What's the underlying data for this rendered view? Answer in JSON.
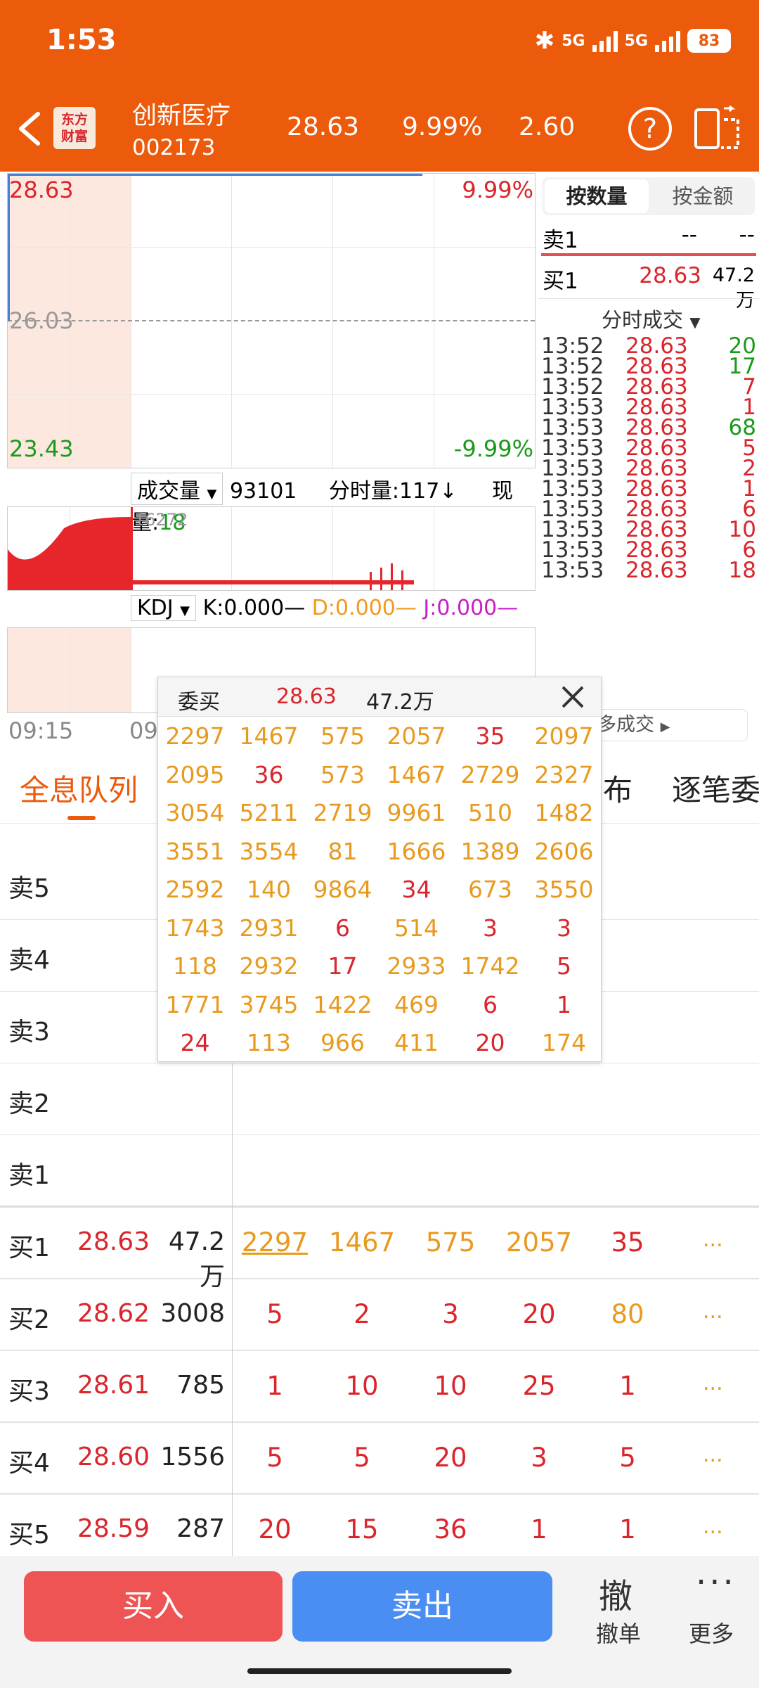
{
  "status": {
    "time": "1:53",
    "battery": "83",
    "network1": "5G",
    "network2": "5G"
  },
  "header": {
    "logo_text": "东方\n财富",
    "stock_name": "创新医疗",
    "stock_code": "002173",
    "price": "28.63",
    "pct": "9.99%",
    "change": "2.60",
    "help": "?"
  },
  "chart": {
    "max_price": "28.63",
    "max_pct": "9.99%",
    "mid_price": "26.03",
    "min_price": "23.43",
    "min_pct": "-9.99%",
    "vol_selector": "成交量",
    "vol_total": "93101",
    "vol_ts_label": "分时量:117↓",
    "vol_now_label": "现量:",
    "vol_now": "18",
    "vol_max": "16272",
    "kdj_selector": "KDJ",
    "k": "K:0.000",
    "d": "D:0.000",
    "j": "J:0.000",
    "time_start": "09:15",
    "time_mid": "09"
  },
  "right_panel": {
    "tabs": [
      "按数量",
      "按金额"
    ],
    "sell1": {
      "label": "卖1",
      "price": "--",
      "vol": "--"
    },
    "buy1": {
      "label": "买1",
      "price": "28.63",
      "vol": "47.2万"
    },
    "ticks_title": "分时成交",
    "ticks": [
      {
        "t": "13:52",
        "p": "28.63",
        "v": "20",
        "c": "green"
      },
      {
        "t": "13:52",
        "p": "28.63",
        "v": "17",
        "c": "green"
      },
      {
        "t": "13:52",
        "p": "28.63",
        "v": "7",
        "c": "red"
      },
      {
        "t": "13:53",
        "p": "28.63",
        "v": "1",
        "c": "red"
      },
      {
        "t": "13:53",
        "p": "28.63",
        "v": "68",
        "c": "green"
      },
      {
        "t": "13:53",
        "p": "28.63",
        "v": "5",
        "c": "red"
      },
      {
        "t": "13:53",
        "p": "28.63",
        "v": "2",
        "c": "red"
      },
      {
        "t": "13:53",
        "p": "28.63",
        "v": "1",
        "c": "red"
      },
      {
        "t": "13:53",
        "p": "28.63",
        "v": "6",
        "c": "red"
      },
      {
        "t": "13:53",
        "p": "28.63",
        "v": "10",
        "c": "red"
      },
      {
        "t": "13:53",
        "p": "28.63",
        "v": "6",
        "c": "red"
      },
      {
        "t": "13:53",
        "p": "28.63",
        "v": "18",
        "c": "red"
      }
    ],
    "more_trades": "更多成交"
  },
  "tabs_row": {
    "queue": "全息队列",
    "dist": "布",
    "each": "逐笔委"
  },
  "order_book": {
    "sells": [
      "卖5",
      "卖4",
      "卖3",
      "卖2",
      "卖1"
    ],
    "buys": [
      {
        "label": "买1",
        "price": "28.63",
        "vol": "47.2万",
        "q": [
          {
            "v": "2297",
            "c": "orange"
          },
          {
            "v": "1467",
            "c": "orange"
          },
          {
            "v": "575",
            "c": "orange"
          },
          {
            "v": "2057",
            "c": "orange"
          },
          {
            "v": "35",
            "c": "red"
          }
        ]
      },
      {
        "label": "买2",
        "price": "28.62",
        "vol": "3008",
        "q": [
          {
            "v": "5",
            "c": "red"
          },
          {
            "v": "2",
            "c": "red"
          },
          {
            "v": "3",
            "c": "red"
          },
          {
            "v": "20",
            "c": "red"
          },
          {
            "v": "80",
            "c": "orange"
          }
        ]
      },
      {
        "label": "买3",
        "price": "28.61",
        "vol": "785",
        "q": [
          {
            "v": "1",
            "c": "red"
          },
          {
            "v": "10",
            "c": "red"
          },
          {
            "v": "10",
            "c": "red"
          },
          {
            "v": "25",
            "c": "red"
          },
          {
            "v": "1",
            "c": "red"
          }
        ]
      },
      {
        "label": "买4",
        "price": "28.60",
        "vol": "1556",
        "q": [
          {
            "v": "5",
            "c": "red"
          },
          {
            "v": "5",
            "c": "red"
          },
          {
            "v": "20",
            "c": "red"
          },
          {
            "v": "3",
            "c": "red"
          },
          {
            "v": "5",
            "c": "red"
          }
        ]
      },
      {
        "label": "买5",
        "price": "28.59",
        "vol": "287",
        "q": [
          {
            "v": "20",
            "c": "red"
          },
          {
            "v": "15",
            "c": "red"
          },
          {
            "v": "36",
            "c": "red"
          },
          {
            "v": "1",
            "c": "red"
          },
          {
            "v": "1",
            "c": "red"
          }
        ]
      }
    ],
    "more": "..."
  },
  "popup": {
    "title": "委买",
    "price": "28.63",
    "vol": "47.2万",
    "grid": [
      [
        {
          "v": "2297",
          "c": "orange"
        },
        {
          "v": "1467",
          "c": "orange"
        },
        {
          "v": "575",
          "c": "orange"
        },
        {
          "v": "2057",
          "c": "orange"
        },
        {
          "v": "35",
          "c": "red"
        },
        {
          "v": "2097",
          "c": "orange"
        }
      ],
      [
        {
          "v": "2095",
          "c": "orange"
        },
        {
          "v": "36",
          "c": "red"
        },
        {
          "v": "573",
          "c": "orange"
        },
        {
          "v": "1467",
          "c": "orange"
        },
        {
          "v": "2729",
          "c": "orange"
        },
        {
          "v": "2327",
          "c": "orange"
        }
      ],
      [
        {
          "v": "3054",
          "c": "orange"
        },
        {
          "v": "5211",
          "c": "orange"
        },
        {
          "v": "2719",
          "c": "orange"
        },
        {
          "v": "9961",
          "c": "orange"
        },
        {
          "v": "510",
          "c": "orange"
        },
        {
          "v": "1482",
          "c": "orange"
        }
      ],
      [
        {
          "v": "3551",
          "c": "orange"
        },
        {
          "v": "3554",
          "c": "orange"
        },
        {
          "v": "81",
          "c": "orange"
        },
        {
          "v": "1666",
          "c": "orange"
        },
        {
          "v": "1389",
          "c": "orange"
        },
        {
          "v": "2606",
          "c": "orange"
        }
      ],
      [
        {
          "v": "2592",
          "c": "orange"
        },
        {
          "v": "140",
          "c": "orange"
        },
        {
          "v": "9864",
          "c": "orange"
        },
        {
          "v": "34",
          "c": "red"
        },
        {
          "v": "673",
          "c": "orange"
        },
        {
          "v": "3550",
          "c": "orange"
        }
      ],
      [
        {
          "v": "1743",
          "c": "orange"
        },
        {
          "v": "2931",
          "c": "orange"
        },
        {
          "v": "6",
          "c": "red"
        },
        {
          "v": "514",
          "c": "orange"
        },
        {
          "v": "3",
          "c": "red"
        },
        {
          "v": "3",
          "c": "red"
        }
      ],
      [
        {
          "v": "118",
          "c": "orange"
        },
        {
          "v": "2932",
          "c": "orange"
        },
        {
          "v": "17",
          "c": "red"
        },
        {
          "v": "2933",
          "c": "orange"
        },
        {
          "v": "1742",
          "c": "orange"
        },
        {
          "v": "5",
          "c": "red"
        }
      ],
      [
        {
          "v": "1771",
          "c": "orange"
        },
        {
          "v": "3745",
          "c": "orange"
        },
        {
          "v": "1422",
          "c": "orange"
        },
        {
          "v": "469",
          "c": "orange"
        },
        {
          "v": "6",
          "c": "red"
        },
        {
          "v": "1",
          "c": "red"
        }
      ],
      [
        {
          "v": "24",
          "c": "red"
        },
        {
          "v": "113",
          "c": "orange"
        },
        {
          "v": "966",
          "c": "orange"
        },
        {
          "v": "411",
          "c": "orange"
        },
        {
          "v": "20",
          "c": "red"
        },
        {
          "v": "174",
          "c": "orange"
        }
      ]
    ]
  },
  "bottom": {
    "buy": "买入",
    "sell": "卖出",
    "cancel_glyph": "撤",
    "cancel": "撤单",
    "more_glyph": "···",
    "more": "更多"
  },
  "colors": {
    "brand": "#ec5a0c",
    "up": "#d9252b",
    "down": "#1a9a1a",
    "queue": "#e89a1f",
    "buy_btn": "#ef5454",
    "sell_btn": "#4a8ef3"
  }
}
